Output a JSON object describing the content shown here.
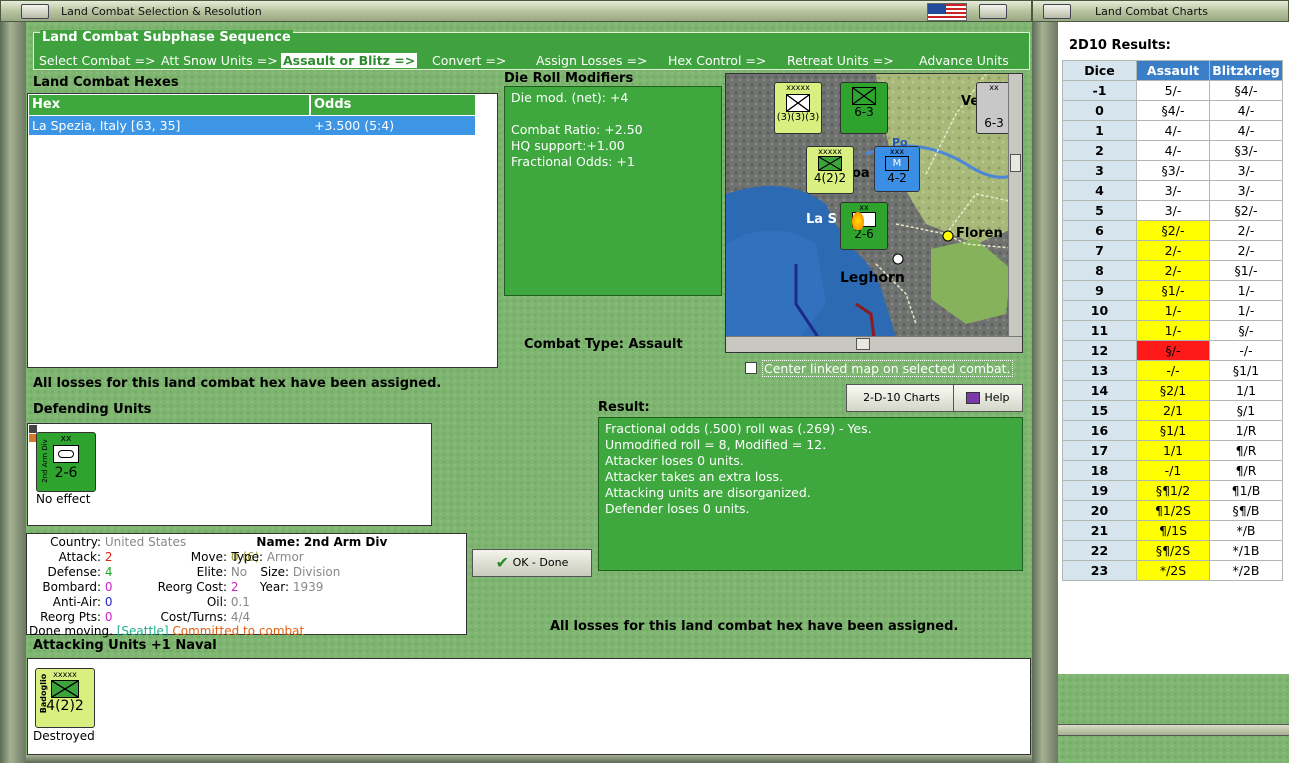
{
  "window_main": {
    "title": "Land Combat Selection & Resolution"
  },
  "window_charts": {
    "title": "Land Combat Charts"
  },
  "sequence": {
    "header": "Land Combat Subphase Sequence",
    "steps": [
      "Select Combat =>",
      "Att Snow Units =>",
      "Assault or Blitz =>",
      "Convert =>",
      "Assign Losses =>",
      "Hex Control =>",
      "Retreat Units =>",
      "Advance Units"
    ]
  },
  "hexes": {
    "label": "Land Combat Hexes",
    "col_hex": "Hex",
    "col_odds": "Odds",
    "rows": [
      {
        "hex": "La Spezia, Italy [63, 35]",
        "odds": "+3.500 (5:4)"
      }
    ]
  },
  "modifiers": {
    "label": "Die Roll Modifiers",
    "lines": [
      "Die mod. (net): +4",
      "",
      "Combat Ratio: +2.50",
      "HQ support:+1.00",
      "Fractional Odds: +1"
    ]
  },
  "combat_type": "Combat Type:  Assault",
  "losses_note": "All losses for this land combat hex have been assigned.",
  "center_map_label": "Center linked map on selected combat.",
  "buttons": {
    "charts": "2-D-10 Charts",
    "help": "Help",
    "ok": "OK - Done"
  },
  "defending": {
    "label": "Defending Units",
    "unit": {
      "type": "xx",
      "side_text": "2nd Arm Div",
      "strength": "2-6",
      "status": "No effect"
    }
  },
  "result": {
    "label": "Result:",
    "lines": [
      "Fractional odds (.500) roll was (.269)  - Yes.",
      "Unmodified roll = 8, Modified = 12.",
      "Attacker loses 0 units.",
      "Attacker takes an extra loss.",
      "Attacking units are disorganized.",
      "Defender loses 0 units."
    ]
  },
  "unit_info": {
    "country_k": "Country:",
    "country_v": "United States",
    "attack_k": "Attack:",
    "attack_v": "2",
    "defense_k": "Defense:",
    "defense_v": "4",
    "bombard_k": "Bombard:",
    "bombard_v": "0",
    "antiair_k": "Anti-Air:",
    "antiair_v": "0",
    "reorgpts_k": "Reorg Pts:",
    "reorgpts_v": "0",
    "name_k": "Name:",
    "name_v": "2nd Arm Div",
    "move_k": "Move:",
    "move_v": "0 (6)",
    "type_k": "Type:",
    "type_v": "Armor",
    "elite_k": "Elite:",
    "elite_v": "No",
    "size_k": "Size:",
    "size_v": "Division",
    "reorg_k": "Reorg Cost:",
    "reorg_v": "2",
    "year_k": "Year:",
    "year_v": "1939",
    "oil_k": "Oil:",
    "oil_v": "0.1",
    "cost_k": "Cost/Turns:",
    "cost_v": "4/4",
    "status_a": "Done moving.",
    "status_b": "[Seattle]",
    "status_c": "Committed to combat"
  },
  "attacking": {
    "label": "Attacking Units +1 Naval",
    "unit": {
      "type": "xxxxx",
      "side_text": "Badoglio",
      "strength": "4(2)2",
      "status": "Destroyed"
    }
  },
  "map": {
    "labels": [
      "La S",
      "Floren",
      "Leghorn",
      "Ve",
      "Po",
      "oa"
    ],
    "units": [
      {
        "type": "xxxxx",
        "side": "Badoglio",
        "str": "4(2)2"
      },
      {
        "type": "xxx",
        "side": "",
        "str": "4-2"
      },
      {
        "type": "xx",
        "side": "",
        "str": "2-6"
      },
      {
        "type": "",
        "side": "",
        "str": "6-3"
      },
      {
        "type": "xxxxx",
        "side": "",
        "str": "(3)(3)(3)"
      },
      {
        "type": "",
        "side": "",
        "str": "6-3"
      }
    ]
  },
  "charts": {
    "title": "2D10 Results:",
    "headers": [
      "Dice",
      "Assault",
      "Blitzkrieg"
    ],
    "rows": [
      {
        "dice": "-1",
        "assault": "5/-",
        "blitz": "§4/-",
        "hl": ""
      },
      {
        "dice": "0",
        "assault": "§4/-",
        "blitz": "4/-",
        "hl": ""
      },
      {
        "dice": "1",
        "assault": "4/-",
        "blitz": "4/-",
        "hl": ""
      },
      {
        "dice": "2",
        "assault": "4/-",
        "blitz": "§3/-",
        "hl": ""
      },
      {
        "dice": "3",
        "assault": "§3/-",
        "blitz": "3/-",
        "hl": ""
      },
      {
        "dice": "4",
        "assault": "3/-",
        "blitz": "3/-",
        "hl": ""
      },
      {
        "dice": "5",
        "assault": "3/-",
        "blitz": "§2/-",
        "hl": ""
      },
      {
        "dice": "6",
        "assault": "§2/-",
        "blitz": "2/-",
        "hl": "y"
      },
      {
        "dice": "7",
        "assault": "2/-",
        "blitz": "2/-",
        "hl": "y"
      },
      {
        "dice": "8",
        "assault": "2/-",
        "blitz": "§1/-",
        "hl": "y"
      },
      {
        "dice": "9",
        "assault": "§1/-",
        "blitz": "1/-",
        "hl": "y"
      },
      {
        "dice": "10",
        "assault": "1/-",
        "blitz": "1/-",
        "hl": "y"
      },
      {
        "dice": "11",
        "assault": "1/-",
        "blitz": "§/-",
        "hl": "y"
      },
      {
        "dice": "12",
        "assault": "§/-",
        "blitz": "-/-",
        "hl": "rd"
      },
      {
        "dice": "13",
        "assault": "-/-",
        "blitz": "§1/1",
        "hl": "y"
      },
      {
        "dice": "14",
        "assault": "§2/1",
        "blitz": "1/1",
        "hl": "y"
      },
      {
        "dice": "15",
        "assault": "2/1",
        "blitz": "§/1",
        "hl": "y"
      },
      {
        "dice": "16",
        "assault": "§1/1",
        "blitz": "1/R",
        "hl": "y"
      },
      {
        "dice": "17",
        "assault": "1/1",
        "blitz": "¶/R",
        "hl": "y"
      },
      {
        "dice": "18",
        "assault": "-/1",
        "blitz": "¶/R",
        "hl": "y"
      },
      {
        "dice": "19",
        "assault": "§¶1/2",
        "blitz": "¶1/B",
        "hl": "y"
      },
      {
        "dice": "20",
        "assault": "¶1/2S",
        "blitz": "§¶/B",
        "hl": "y"
      },
      {
        "dice": "21",
        "assault": "¶/1S",
        "blitz": "*/B",
        "hl": "y"
      },
      {
        "dice": "22",
        "assault": "§¶/2S",
        "blitz": "*/1B",
        "hl": "y"
      },
      {
        "dice": "23",
        "assault": "*/2S",
        "blitz": "*/2B",
        "hl": "y"
      }
    ]
  },
  "colors": {
    "panel_green": "#3ea83e",
    "felt": "#7eb570",
    "header_blue": "#3a7ec8",
    "highlight": "#ffff00",
    "roll": "#ff1a1a"
  }
}
